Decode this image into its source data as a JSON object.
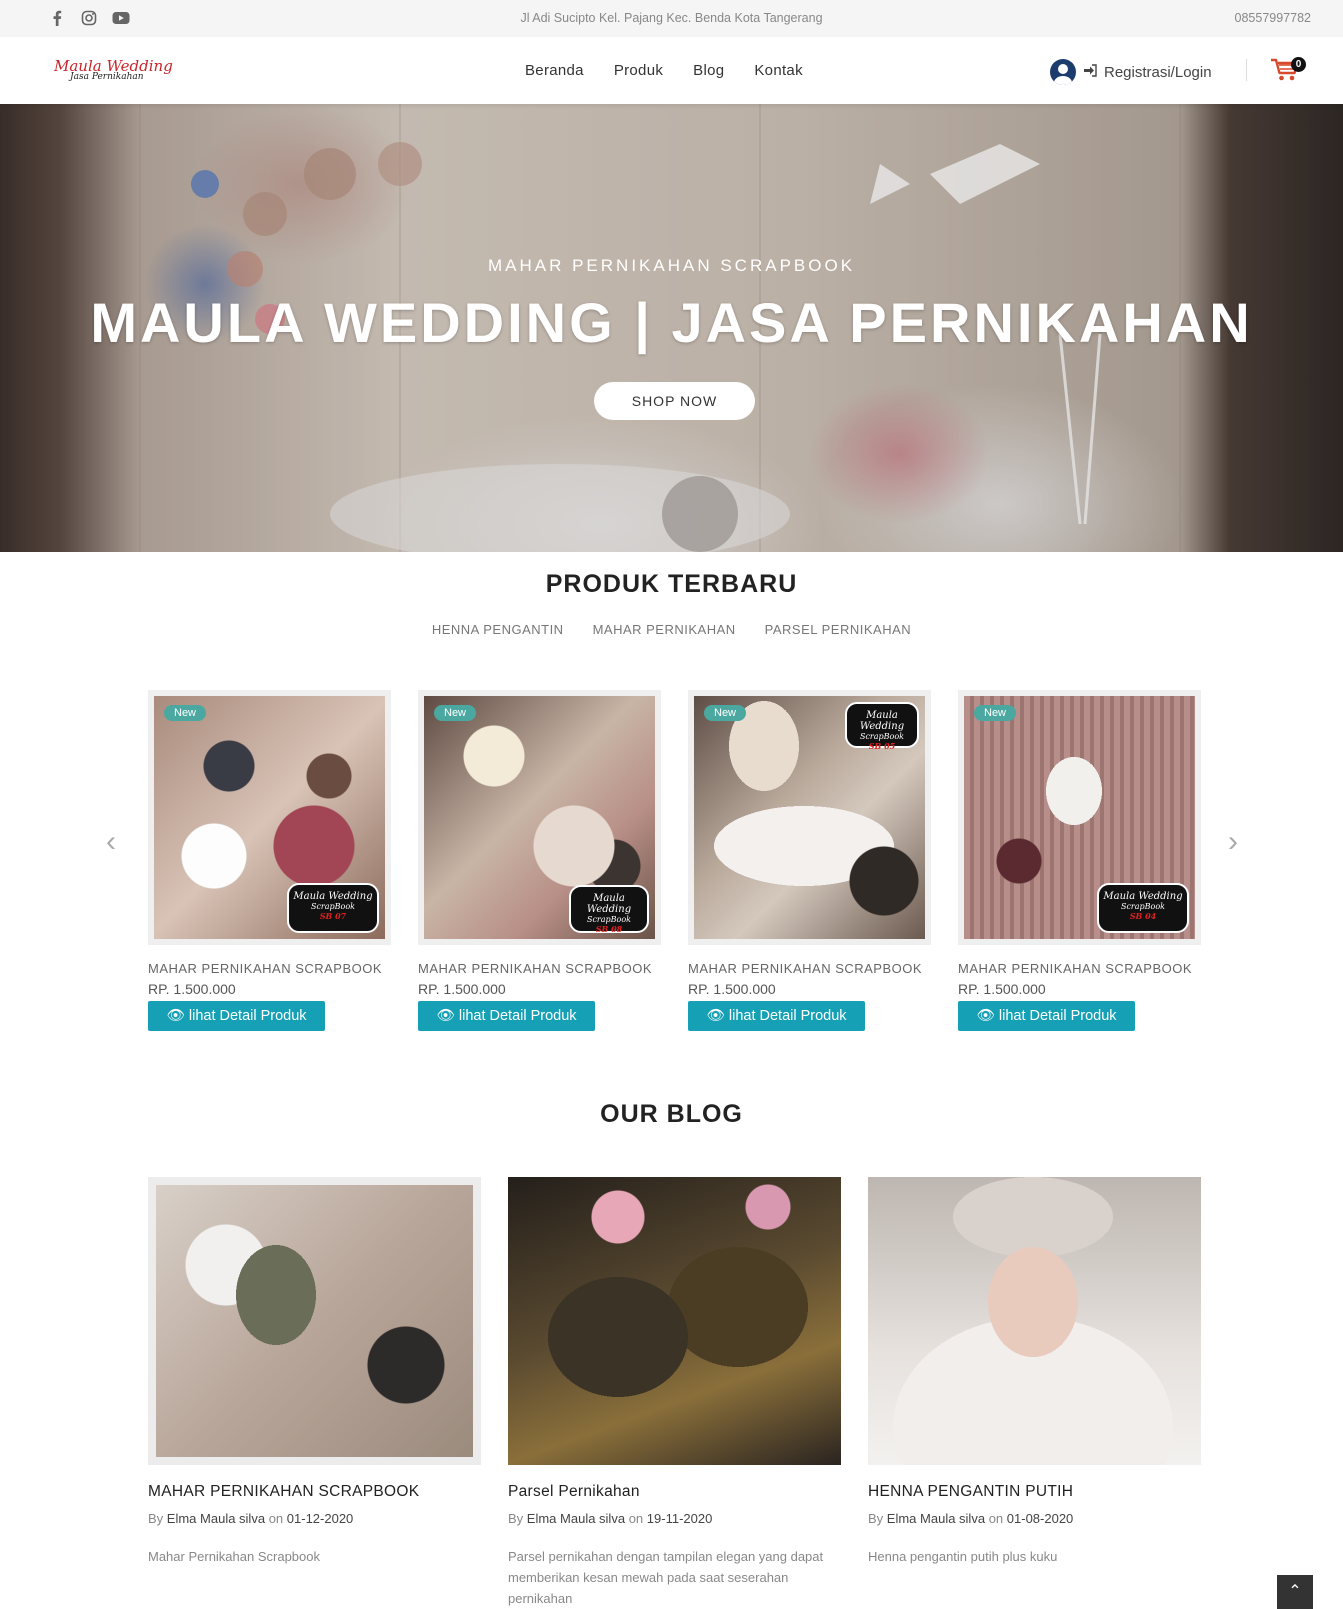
{
  "topbar": {
    "social": [
      "facebook-icon",
      "instagram-icon",
      "youtube-icon"
    ],
    "address": "Jl Adi Sucipto Kel. Pajang Kec. Benda Kota Tangerang",
    "phone": "08557997782"
  },
  "header": {
    "logo_line1": "Maula Wedding",
    "logo_line2": "Jasa Pernikahan",
    "nav": [
      "Beranda",
      "Produk",
      "Blog",
      "Kontak"
    ],
    "login_label": "Registrasi/Login",
    "cart_count": "0"
  },
  "hero": {
    "subtitle": "MAHAR PERNIKAHAN SCRAPBOOK",
    "title": "MAULA WEDDING | JASA PERNIKAHAN",
    "button": "SHOP NOW"
  },
  "products_section": {
    "title": "PRODUK TERBARU",
    "filters": [
      "HENNA PENGANTIN",
      "MAHAR PERNIKAHAN",
      "PARSEL PERNIKAHAN"
    ],
    "items": [
      {
        "tag": "New",
        "name": "MAHAR PERNIKAHAN SCRAPBOOK",
        "price": "RP. 1.500.000",
        "button": "lihat Detail Produk",
        "seal_line1": "Maula Wedding",
        "seal_line2": "ScrapBook",
        "seal_code": "SB 07"
      },
      {
        "tag": "New",
        "name": "MAHAR PERNIKAHAN SCRAPBOOK",
        "price": "RP. 1.500.000",
        "button": "lihat Detail Produk",
        "seal_line1": "Maula Wedding",
        "seal_line2": "ScrapBook",
        "seal_code": "SB 08"
      },
      {
        "tag": "New",
        "name": "MAHAR PERNIKAHAN SCRAPBOOK",
        "price": "RP. 1.500.000",
        "button": "lihat Detail Produk",
        "seal_line1": "Maula Wedding",
        "seal_line2": "ScrapBook",
        "seal_code": "SB 05"
      },
      {
        "tag": "New",
        "name": "MAHAR PERNIKAHAN SCRAPBOOK",
        "price": "RP. 1.500.000",
        "button": "lihat Detail Produk",
        "seal_line1": "Maula Wedding",
        "seal_line2": "ScrapBook",
        "seal_code": "SB 04"
      }
    ]
  },
  "blog_section": {
    "title": "OUR BLOG",
    "posts": [
      {
        "title": "MAHAR PERNIKAHAN SCRAPBOOK",
        "by": "By",
        "author": "Elma Maula silva",
        "on": "on",
        "date": "01-12-2020",
        "excerpt": "Mahar Pernikahan Scrapbook"
      },
      {
        "title": "Parsel Pernikahan",
        "by": "By",
        "author": "Elma Maula silva",
        "on": "on",
        "date": "19-11-2020",
        "excerpt": "Parsel pernikahan dengan tampilan elegan yang dapat memberikan kesan mewah pada saat seserahan pernikahan"
      },
      {
        "title": "HENNA PENGANTIN PUTIH",
        "by": "By",
        "author": "Elma Maula silva",
        "on": "on",
        "date": "01-08-2020",
        "excerpt": "Henna pengantin putih plus kuku"
      }
    ]
  },
  "colors": {
    "accent": "#16a0b5",
    "tag": "#4aa8a0",
    "topbar_bg": "#f5f5f5"
  }
}
